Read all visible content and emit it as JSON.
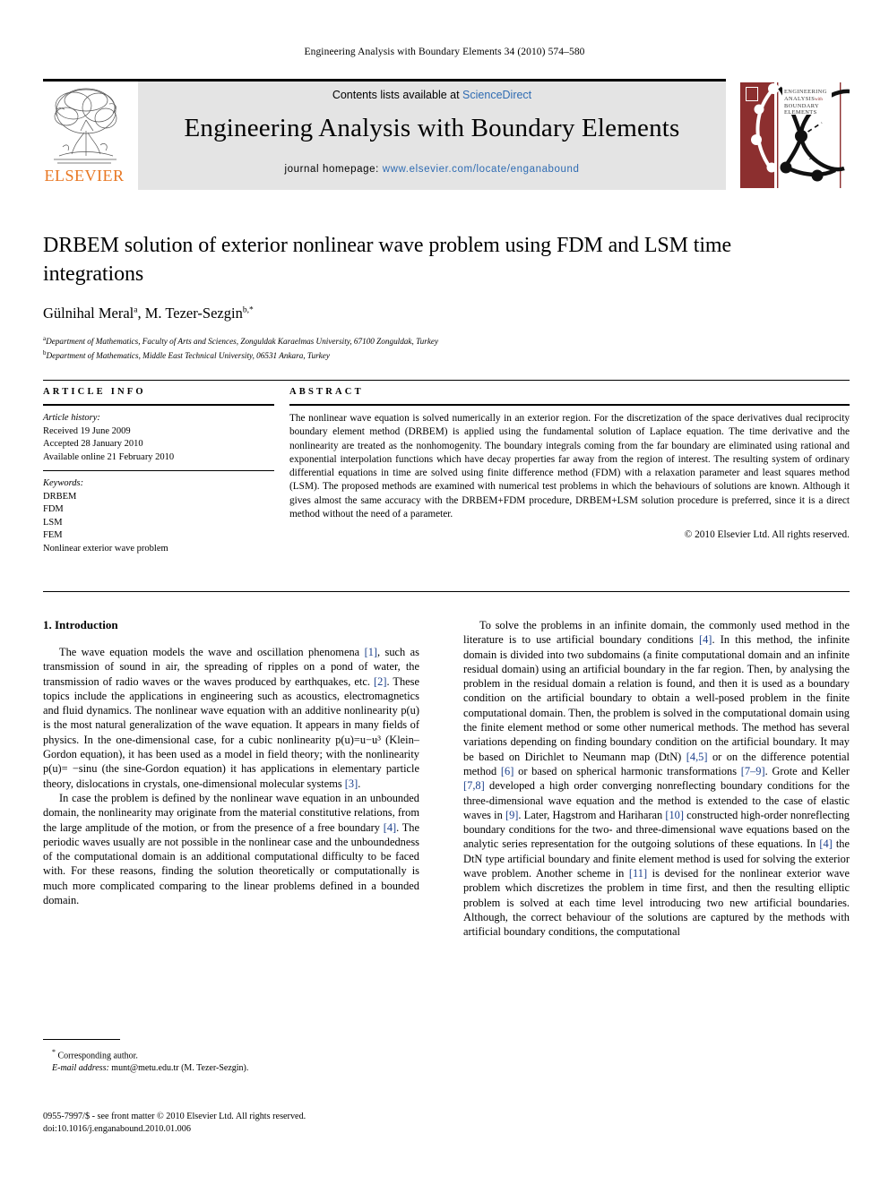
{
  "running_head": "Engineering Analysis with Boundary Elements 34 (2010) 574–580",
  "masthead": {
    "contents_prefix": "Contents lists available at ",
    "contents_link": "ScienceDirect",
    "journal_title": "Engineering Analysis with Boundary Elements",
    "homepage_prefix": "journal homepage: ",
    "homepage_url": "www.elsevier.com/locate/enganabound",
    "publisher_wordmark": "ELSEVIER",
    "cover_title_lines": [
      "ENGINEERING",
      "ANALYSIS",
      "BOUNDARY",
      "ELEMENTS"
    ],
    "cover_small_word": "with",
    "accent_orange": "#E87722",
    "link_blue": "#2e6bb2",
    "cover_maroon": "#8c2f2f",
    "band_grey": "#e4e4e4"
  },
  "title": "DRBEM solution of exterior nonlinear wave problem using FDM and LSM time integrations",
  "authors": {
    "author1": "Gülnihal Meral",
    "author1_mark": "a",
    "separator": ", ",
    "author2": "M. Tezer-Sezgin",
    "author2_mark": "b,*"
  },
  "affiliations": [
    {
      "mark": "a",
      "text": "Department of Mathematics, Faculty of Arts and Sciences, Zonguldak Karaelmas University, 67100 Zonguldak, Turkey"
    },
    {
      "mark": "b",
      "text": "Department of Mathematics, Middle East Technical University, 06531 Ankara, Turkey"
    }
  ],
  "article_info": {
    "heading": "ARTICLE INFO",
    "history_label": "Article history:",
    "history": [
      "Received 19 June 2009",
      "Accepted 28 January 2010",
      "Available online 21 February 2010"
    ],
    "keywords_label": "Keywords:",
    "keywords": [
      "DRBEM",
      "FDM",
      "LSM",
      "FEM",
      "Nonlinear exterior wave problem"
    ]
  },
  "abstract": {
    "heading": "ABSTRACT",
    "text": "The nonlinear wave equation is solved numerically in an exterior region. For the discretization of the space derivatives dual reciprocity boundary element method (DRBEM) is applied using the fundamental solution of Laplace equation. The time derivative and the nonlinearity are treated as the nonhomogenity. The boundary integrals coming from the far boundary are eliminated using rational and exponential interpolation functions which have decay properties far away from the region of interest. The resulting system of ordinary differential equations in time are solved using finite difference method (FDM) with a relaxation parameter and least squares method (LSM). The proposed methods are examined with numerical test problems in which the behaviours of solutions are known. Although it gives almost the same accuracy with the DRBEM+FDM procedure, DRBEM+LSM solution procedure is preferred, since it is a direct method without the need of a parameter.",
    "copyright": "© 2010 Elsevier Ltd. All rights reserved."
  },
  "body": {
    "section_number_title": "1. Introduction",
    "left_paragraphs": [
      "The wave equation models the wave and oscillation phenomena [1], such as transmission of sound in air, the spreading of ripples on a pond of water, the transmission of radio waves or the waves produced by earthquakes, etc. [2]. These topics include the applications in engineering such as acoustics, electromagnetics and fluid dynamics. The nonlinear wave equation with an additive nonlinearity p(u) is the most natural generalization of the wave equation. It appears in many fields of physics. In the one-dimensional case, for a cubic nonlinearity p(u)=u−u³ (Klein–Gordon equation), it has been used as a model in field theory; with the nonlinearity p(u)= −sinu (the sine-Gordon equation) it has applications in elementary particle theory, dislocations in crystals, one-dimensional molecular systems [3].",
      "In case the problem is defined by the nonlinear wave equation in an unbounded domain, the nonlinearity may originate from the material constitutive relations, from the large amplitude of the motion, or from the presence of a free boundary [4]. The periodic waves usually are not possible in the nonlinear case and the unboundedness of the computational domain is an additional computational difficulty to be faced with. For these reasons, finding the solution theoretically or computationally is much more complicated comparing to the linear problems defined in a bounded domain."
    ],
    "right_paragraphs": [
      "To solve the problems in an infinite domain, the commonly used method in the literature is to use artificial boundary conditions [4]. In this method, the infinite domain is divided into two subdomains (a finite computational domain and an infinite residual domain) using an artificial boundary in the far region. Then, by analysing the problem in the residual domain a relation is found, and then it is used as a boundary condition on the artificial boundary to obtain a well-posed problem in the finite computational domain. Then, the problem is solved in the computational domain using the finite element method or some other numerical methods. The method has several variations depending on finding boundary condition on the artificial boundary. It may be based on Dirichlet to Neumann map (DtN) [4,5] or on the difference potential method [6] or based on spherical harmonic transformations [7–9]. Grote and Keller [7,8] developed a high order converging nonreflecting boundary conditions for the three-dimensional wave equation and the method is extended to the case of elastic waves in [9]. Later, Hagstrom and Hariharan [10] constructed high-order nonreflecting boundary conditions for the two- and three-dimensional wave equations based on the analytic series representation for the outgoing solutions of these equations. In [4] the DtN type artificial boundary and finite element method is used for solving the exterior wave problem. Another scheme in [11] is devised for the nonlinear exterior wave problem which discretizes the problem in time first, and then the resulting elliptic problem is solved at each time level introducing two new artificial boundaries. Although, the correct behaviour of the solutions are captured by the methods with artificial boundary conditions, the computational"
    ],
    "reference_color": "#1b3f8b"
  },
  "footnotes": {
    "corresponding_marker": "*",
    "corresponding_text": "Corresponding author.",
    "email_label": "E-mail address:",
    "email_value": "munt@metu.edu.tr (M. Tezer-Sezgin)."
  },
  "imprint": {
    "line1": "0955-7997/$ - see front matter © 2010 Elsevier Ltd. All rights reserved.",
    "line2": "doi:10.1016/j.enganabound.2010.01.006"
  }
}
